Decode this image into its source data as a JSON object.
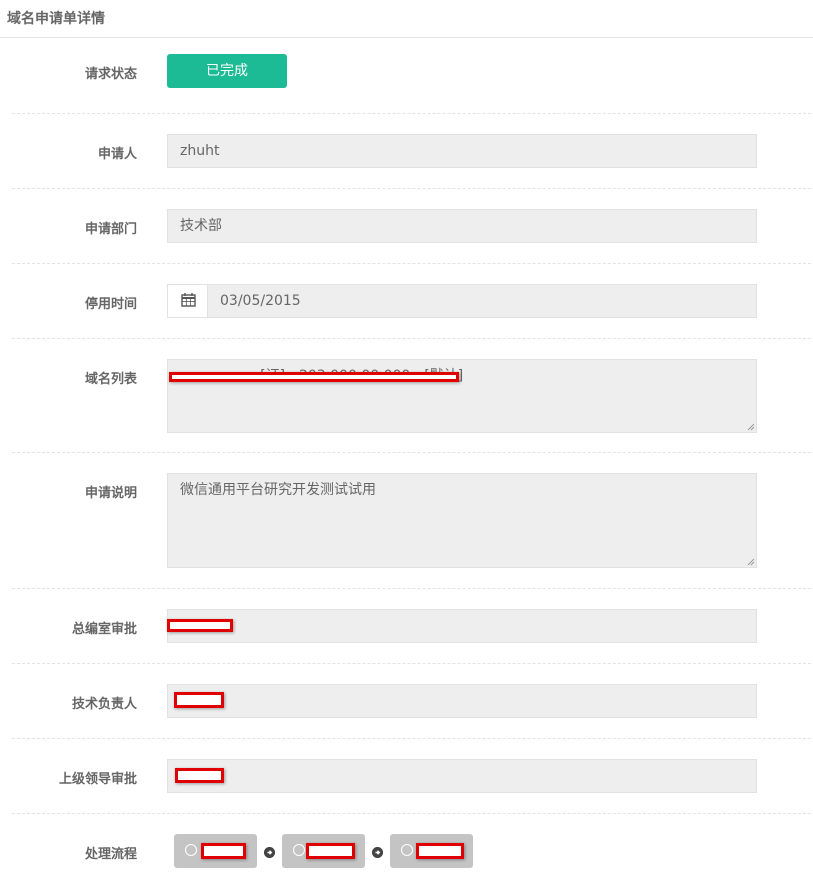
{
  "header": {
    "title": "域名申请单详情"
  },
  "form": {
    "status": {
      "label": "请求状态",
      "value": "已完成"
    },
    "applicant": {
      "label": "申请人",
      "value": "zhuht"
    },
    "department": {
      "label": "申请部门",
      "value": "技术部"
    },
    "stop_time": {
      "label": "停用时间",
      "value": "03/05/2015",
      "icon": "calendar-icon"
    },
    "domain_list": {
      "label": "域名列表",
      "value": "                  [证] - 203.000.00.000 - [默认]"
    },
    "description": {
      "label": "申请说明",
      "value": "微信通用平台研究开发测试试用"
    },
    "editor_approval": {
      "label": "总编室审批",
      "value": ""
    },
    "tech_lead": {
      "label": "技术负责人",
      "value": ""
    },
    "leader_approval": {
      "label": "上级领导审批",
      "value": ""
    },
    "process": {
      "label": "处理流程",
      "steps": [
        {
          "icon": "check-circle-icon",
          "label": ""
        },
        {
          "icon": "check-circle-icon",
          "label": ""
        },
        {
          "icon": "check-circle-icon",
          "label": ""
        }
      ],
      "arrow_icon": "arrow-right-circle-icon"
    }
  }
}
